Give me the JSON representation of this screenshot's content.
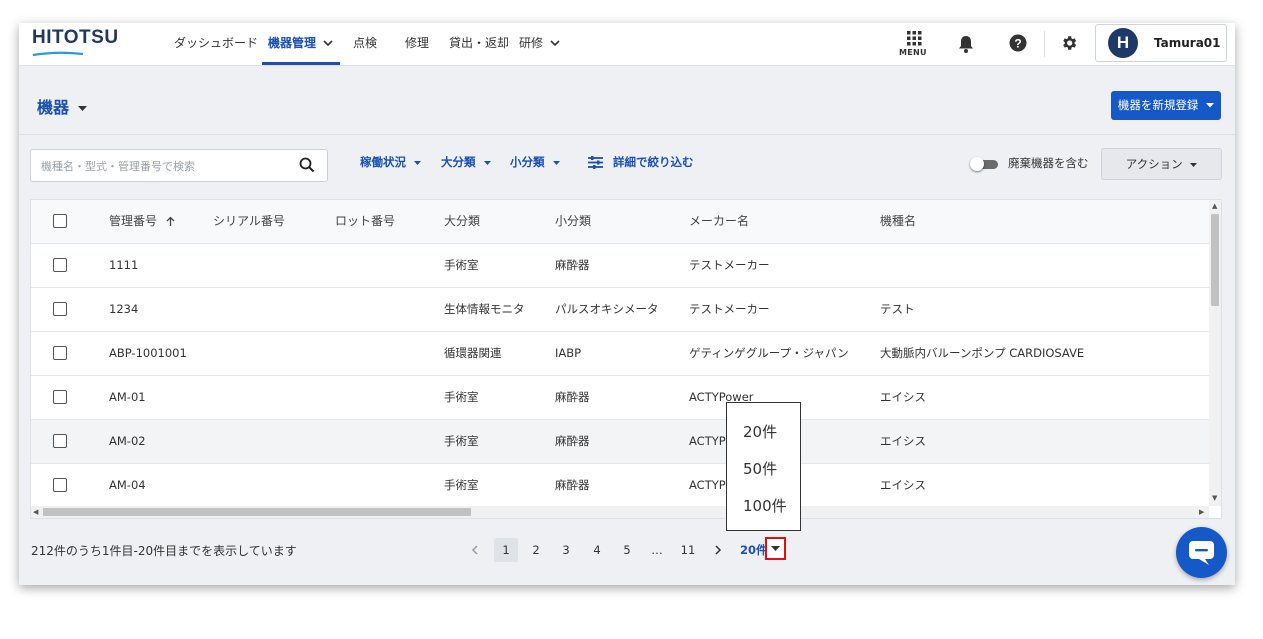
{
  "nav": {
    "logo": "HITOTSU",
    "items": [
      {
        "label": "ダッシュボード"
      },
      {
        "label": "機器管理"
      },
      {
        "label": "点検"
      },
      {
        "label": "修理"
      },
      {
        "label": "貸出・返却"
      },
      {
        "label": "研修"
      }
    ],
    "menu_label": "MENU",
    "user": {
      "initial": "H",
      "name": "Tamura01"
    }
  },
  "page": {
    "title": "機器",
    "register_button": "機器を新規登録"
  },
  "filters": {
    "search_placeholder": "機種名・型式・管理番号で検索",
    "status": "稼働状況",
    "major_category": "大分類",
    "minor_category": "小分類",
    "advanced": "詳細で絞り込む",
    "include_disposed": "廃棄機器を含む",
    "include_disposed_on": false,
    "action": "アクション"
  },
  "table": {
    "columns": [
      "管理番号",
      "シリアル番号",
      "ロット番号",
      "大分類",
      "小分類",
      "メーカー名",
      "機種名"
    ],
    "rows": [
      {
        "id": "1111",
        "serial": "",
        "lot": "",
        "major": "手術室",
        "minor": "麻酔器",
        "maker": "テストメーカー",
        "model": ""
      },
      {
        "id": "1234",
        "serial": "",
        "lot": "",
        "major": "生体情報モニタ",
        "minor": "パルスオキシメータ",
        "maker": "テストメーカー",
        "model": "テスト"
      },
      {
        "id": "ABP-1001001",
        "serial": "",
        "lot": "",
        "major": "循環器関連",
        "minor": "IABP",
        "maker": "ゲティンゲグループ・ジャパン",
        "model": "大動脈内バルーンポンプ CARDIOSAVE"
      },
      {
        "id": "AM-01",
        "serial": "",
        "lot": "",
        "major": "手術室",
        "minor": "麻酔器",
        "maker": "ACTYPower",
        "model": "エイシス"
      },
      {
        "id": "AM-02",
        "serial": "",
        "lot": "",
        "major": "手術室",
        "minor": "麻酔器",
        "maker": "ACTYP",
        "model": "エイシス"
      },
      {
        "id": "AM-04",
        "serial": "",
        "lot": "",
        "major": "手術室",
        "minor": "麻酔器",
        "maker": "ACTYP",
        "model": "エイシス"
      }
    ]
  },
  "pagination": {
    "summary": "212件のうち1件目-20件目までを表示しています",
    "pages": [
      "1",
      "2",
      "3",
      "4",
      "5",
      "…",
      "11"
    ],
    "current_page": "1",
    "per_page": "20件",
    "per_page_options": [
      "20件",
      "50件",
      "100件"
    ]
  },
  "colors": {
    "accent": "#1b4fb3",
    "primary_button": "#1558c7",
    "highlight_border": "#e01010"
  }
}
